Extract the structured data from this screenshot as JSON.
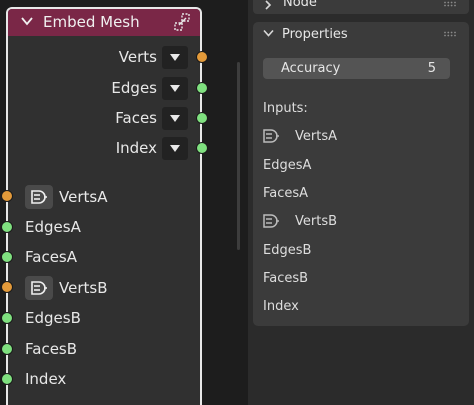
{
  "node": {
    "title": "Embed Mesh",
    "header_color": "#7a2747",
    "icons": {
      "collapse": "chevron-down-icon",
      "header": "node-group-icon"
    },
    "outputs": [
      {
        "label": "Verts",
        "socket": "orange"
      },
      {
        "label": "Edges",
        "socket": "green"
      },
      {
        "label": "Faces",
        "socket": "green"
      },
      {
        "label": "Index",
        "socket": "green"
      }
    ],
    "inputs": [
      {
        "label": "VertsA",
        "socket": "orange",
        "icon": "field-icon"
      },
      {
        "label": "EdgesA",
        "socket": "green"
      },
      {
        "label": "FacesA",
        "socket": "green"
      },
      {
        "label": "VertsB",
        "socket": "orange",
        "icon": "field-icon"
      },
      {
        "label": "EdgesB",
        "socket": "green"
      },
      {
        "label": "FacesB",
        "socket": "green"
      },
      {
        "label": "Index",
        "socket": "green"
      }
    ]
  },
  "sidebar": {
    "node_panel": {
      "label": "Node"
    },
    "properties_panel": {
      "label": "Properties",
      "accuracy": {
        "label": "Accuracy",
        "value": "5"
      },
      "inputs_heading": "Inputs:",
      "inputs": [
        {
          "label": "VertsA",
          "icon": "field-icon"
        },
        {
          "label": "EdgesA"
        },
        {
          "label": "FacesA"
        },
        {
          "label": "VertsB",
          "icon": "field-icon"
        },
        {
          "label": "EdgesB"
        },
        {
          "label": "FacesB"
        },
        {
          "label": "Index"
        }
      ]
    }
  },
  "colors": {
    "socket_orange": "#e39a3a",
    "socket_green": "#7fe07f",
    "node_border": "#e8e8e8"
  }
}
